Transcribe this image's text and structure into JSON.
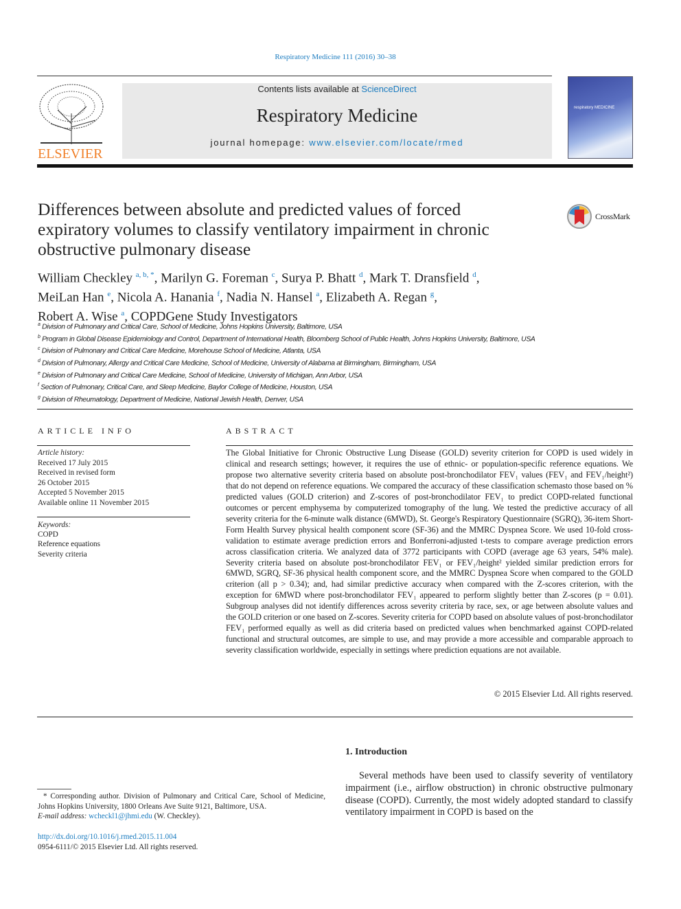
{
  "citation": "Respiratory Medicine 111 (2016) 30–38",
  "header": {
    "publisher_logo": "ELSEVIER",
    "contents_prefix": "Contents lists available at ",
    "contents_link": "ScienceDirect",
    "journal_title": "Respiratory Medicine",
    "homepage_prefix": "journal homepage: ",
    "homepage_link": "www.elsevier.com/locate/rmed",
    "cover_text": "respiratory MEDICINE"
  },
  "crossmark": "CrossMark",
  "title": "Differences between absolute and predicted values of forced expiratory volumes to classify ventilatory impairment in chronic obstructive pulmonary disease",
  "authors": [
    {
      "name": "William Checkley",
      "sup": "a, b, *",
      "sep": ", "
    },
    {
      "name": "Marilyn G. Foreman",
      "sup": "c",
      "sep": ", "
    },
    {
      "name": "Surya P. Bhatt",
      "sup": "d",
      "sep": ", "
    },
    {
      "name": "Mark T. Dransfield",
      "sup": "d",
      "sep": ","
    },
    {
      "name": "MeiLan Han",
      "sup": "e",
      "sep": ", "
    },
    {
      "name": "Nicola A. Hanania",
      "sup": "f",
      "sep": ", "
    },
    {
      "name": "Nadia N. Hansel",
      "sup": "a",
      "sep": ", "
    },
    {
      "name": "Elizabeth A. Regan",
      "sup": "g",
      "sep": ","
    },
    {
      "name": "Robert A. Wise",
      "sup": "a",
      "sep": ", "
    },
    {
      "name": "COPDGene Study Investigators",
      "sup": "",
      "sep": ""
    }
  ],
  "affiliations": [
    {
      "key": "a",
      "text": "Division of Pulmonary and Critical Care, School of Medicine, Johns Hopkins University, Baltimore, USA"
    },
    {
      "key": "b",
      "text": "Program in Global Disease Epidemiology and Control, Department of International Health, Bloomberg School of Public Health, Johns Hopkins University, Baltimore, USA"
    },
    {
      "key": "c",
      "text": "Division of Pulmonary and Critical Care Medicine, Morehouse School of Medicine, Atlanta, USA"
    },
    {
      "key": "d",
      "text": "Division of Pulmonary, Allergy and Critical Care Medicine, School of Medicine, University of Alabama at Birmingham, Birmingham, USA"
    },
    {
      "key": "e",
      "text": "Division of Pulmonary and Critical Care Medicine, School of Medicine, University of Michigan, Ann Arbor, USA"
    },
    {
      "key": "f",
      "text": "Section of Pulmonary, Critical Care, and Sleep Medicine, Baylor College of Medicine, Houston, USA"
    },
    {
      "key": "g",
      "text": "Division of Rheumatology, Department of Medicine, National Jewish Health, Denver, USA"
    }
  ],
  "article_info": {
    "heading": "ARTICLE INFO",
    "history_label": "Article history:",
    "history": [
      "Received 17 July 2015",
      "Received in revised form",
      "26 October 2015",
      "Accepted 5 November 2015",
      "Available online 11 November 2015"
    ],
    "keywords_label": "Keywords:",
    "keywords": [
      "COPD",
      "Reference equations",
      "Severity criteria"
    ]
  },
  "abstract": {
    "heading": "ABSTRACT",
    "text": "The Global Initiative for Chronic Obstructive Lung Disease (GOLD) severity criterion for COPD is used widely in clinical and research settings; however, it requires the use of ethnic- or population-specific reference equations. We propose two alternative severity criteria based on absolute post-bronchodilator FEV₁ values (FEV₁ and FEV₁/height²) that do not depend on reference equations. We compared the accuracy of these classification schemasto those based on % predicted values (GOLD cri­terion) and Z-scores of post-bronchodilator FEV₁ to predict COPD-related functional outcomes or percent emphysema by computerized tomography of the lung. We tested the predictive accuracy of all severity criteria for the 6-minute walk distance (6MWD), St. George's Respiratory Questionnaire (SGRQ), 36-item Short-Form Health Survey physical health component score (SF-36) and the MMRC Dyspnea Score. We used 10-fold cross-validation to estimate average prediction errors and Bonferroni-adjusted t-tests to compare average prediction errors across classification criteria. We analyzed data of 3772 participants with COPD (average age 63 years, 54% male). Severity criteria based on absolute post-bronchodilator FEV₁ or FEV₁/height² yielded similar prediction errors for 6MWD, SGRQ, SF-36 physical health component score, and the MMRC Dyspnea Score when compared to the GOLD criterion (all p > 0.34); and, had similar predictive accuracy when compared with the Z-scores criterion, with the exception for 6MWD where post-bronchodilator FEV₁ appeared to perform slightly better than Z-scores (p = 0.01). Subgroup analyses did not identify differences across severity criteria by race, sex, or age between ab­solute values and the GOLD criterion or one based on Z-scores. Severity criteria for COPD based on ab­solute values of post-bronchodilator FEV₁ performed equally as well as did criteria based on predicted values when benchmarked against COPD-related functional and structural outcomes, are simple to use, and may provide a more accessible and comparable approach to severity classification worldwide, especially in settings where prediction equations are not available.",
    "copyright": "© 2015 Elsevier Ltd. All rights reserved."
  },
  "intro": {
    "heading": "1.  Introduction",
    "text": "Several methods have been used to classify severity of ventila­tory impairment (i.e., airflow obstruction) in chronic obstructive pulmonary disease (COPD). Currently, the most widely adopted standard to classify ventilatory impairment in COPD is based on the"
  },
  "footnote": {
    "text": "* Corresponding author. Division of Pulmonary and Critical Care, School of Medicine, Johns Hopkins University, 1800 Orleans Ave Suite 9121, Baltimore, USA.",
    "email_label": "E-mail address: ",
    "email": "wcheckl1@jhmi.edu",
    "email_suffix": " (W. Checkley)."
  },
  "doi": "http://dx.doi.org/10.1016/j.rmed.2015.11.004",
  "issn": "0954-6111/© 2015 Elsevier Ltd. All rights reserved.",
  "colors": {
    "link": "#1a7bbf",
    "elsevier_orange": "#f07e26",
    "banner_bg": "#e9e9e9"
  }
}
